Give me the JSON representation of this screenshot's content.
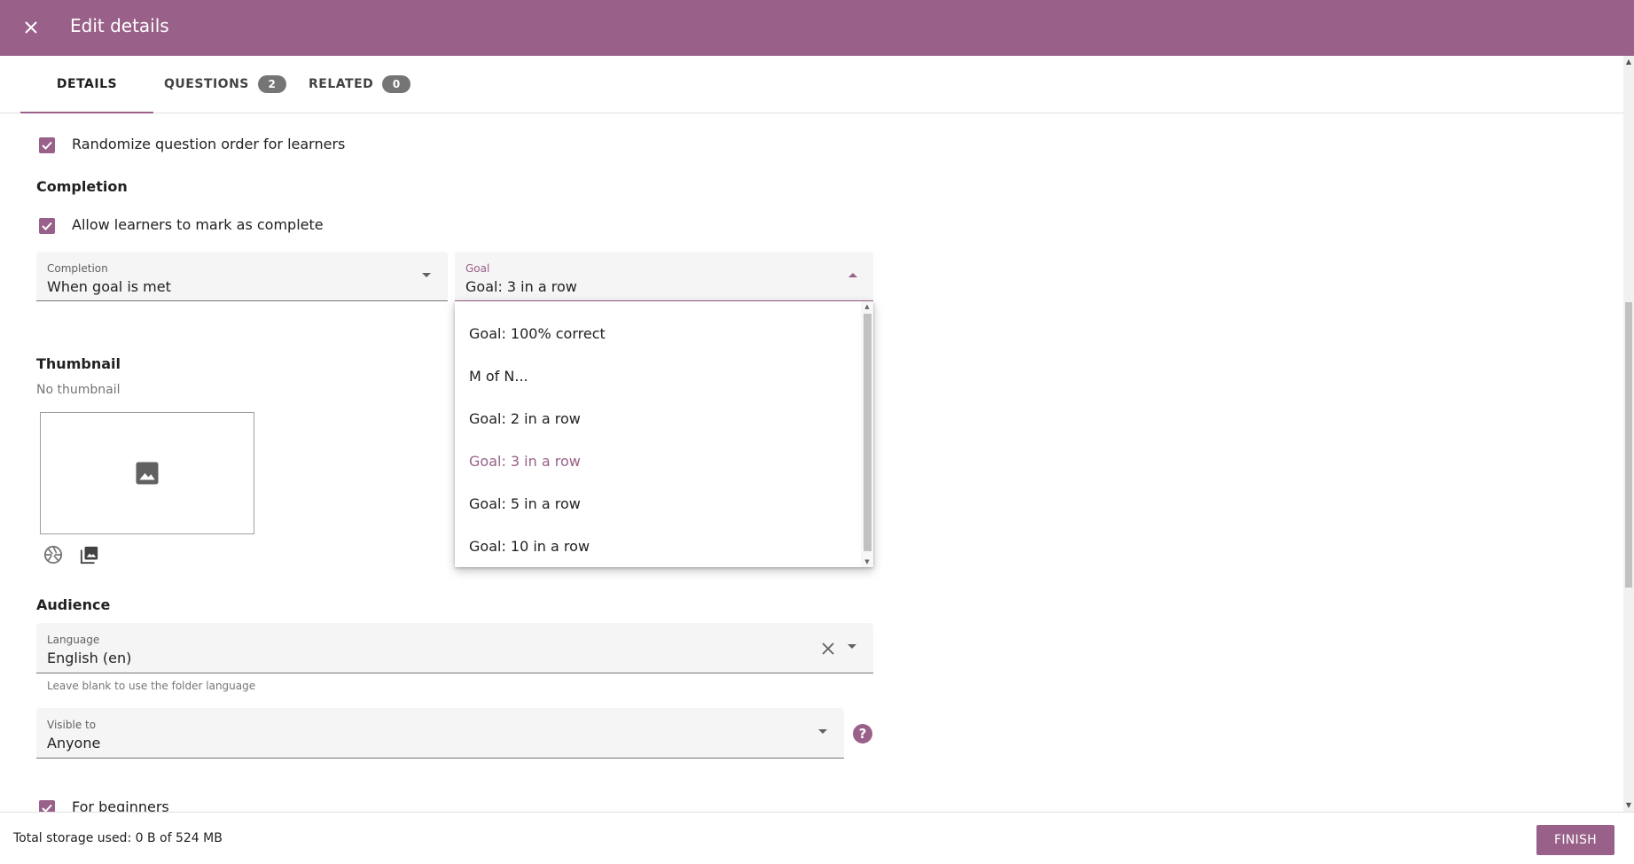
{
  "appbar": {
    "title": "Edit details",
    "close_icon": "close-icon"
  },
  "tabs": [
    {
      "label": "DETAILS"
    },
    {
      "label": "QUESTIONS",
      "count": "2"
    },
    {
      "label": "RELATED",
      "count": "0"
    }
  ],
  "assessment": {
    "randomize_label": "Randomize question order for learners",
    "randomize_checked": true
  },
  "completion": {
    "heading": "Completion",
    "mark_complete_label": "Allow learners to mark as complete",
    "mark_complete_checked": true,
    "completion_field": {
      "label": "Completion",
      "value": "When goal is met"
    },
    "goal_field": {
      "label": "Goal",
      "value": "Goal: 3 in a row"
    },
    "goal_options": [
      "Goal: 100% correct",
      "M of N...",
      "Goal: 2 in a row",
      "Goal: 3 in a row",
      "Goal: 5 in a row",
      "Goal: 10 in a row"
    ],
    "goal_selected": "Goal: 3 in a row"
  },
  "thumbnail": {
    "heading": "Thumbnail",
    "subtitle": "No thumbnail"
  },
  "audience": {
    "heading": "Audience",
    "language_field": {
      "label": "Language",
      "value": "English (en)",
      "hint": "Leave blank to use the folder language"
    },
    "visible_field": {
      "label": "Visible to",
      "value": "Anyone"
    },
    "for_beginners_label": "For beginners",
    "for_beginners_checked": true
  },
  "footer": {
    "storage": "Total storage used: 0 B of 524 MB",
    "finish_label": "FINISH"
  },
  "colors": {
    "primary": "#996189",
    "text": "#212121",
    "muted": "#757575"
  }
}
